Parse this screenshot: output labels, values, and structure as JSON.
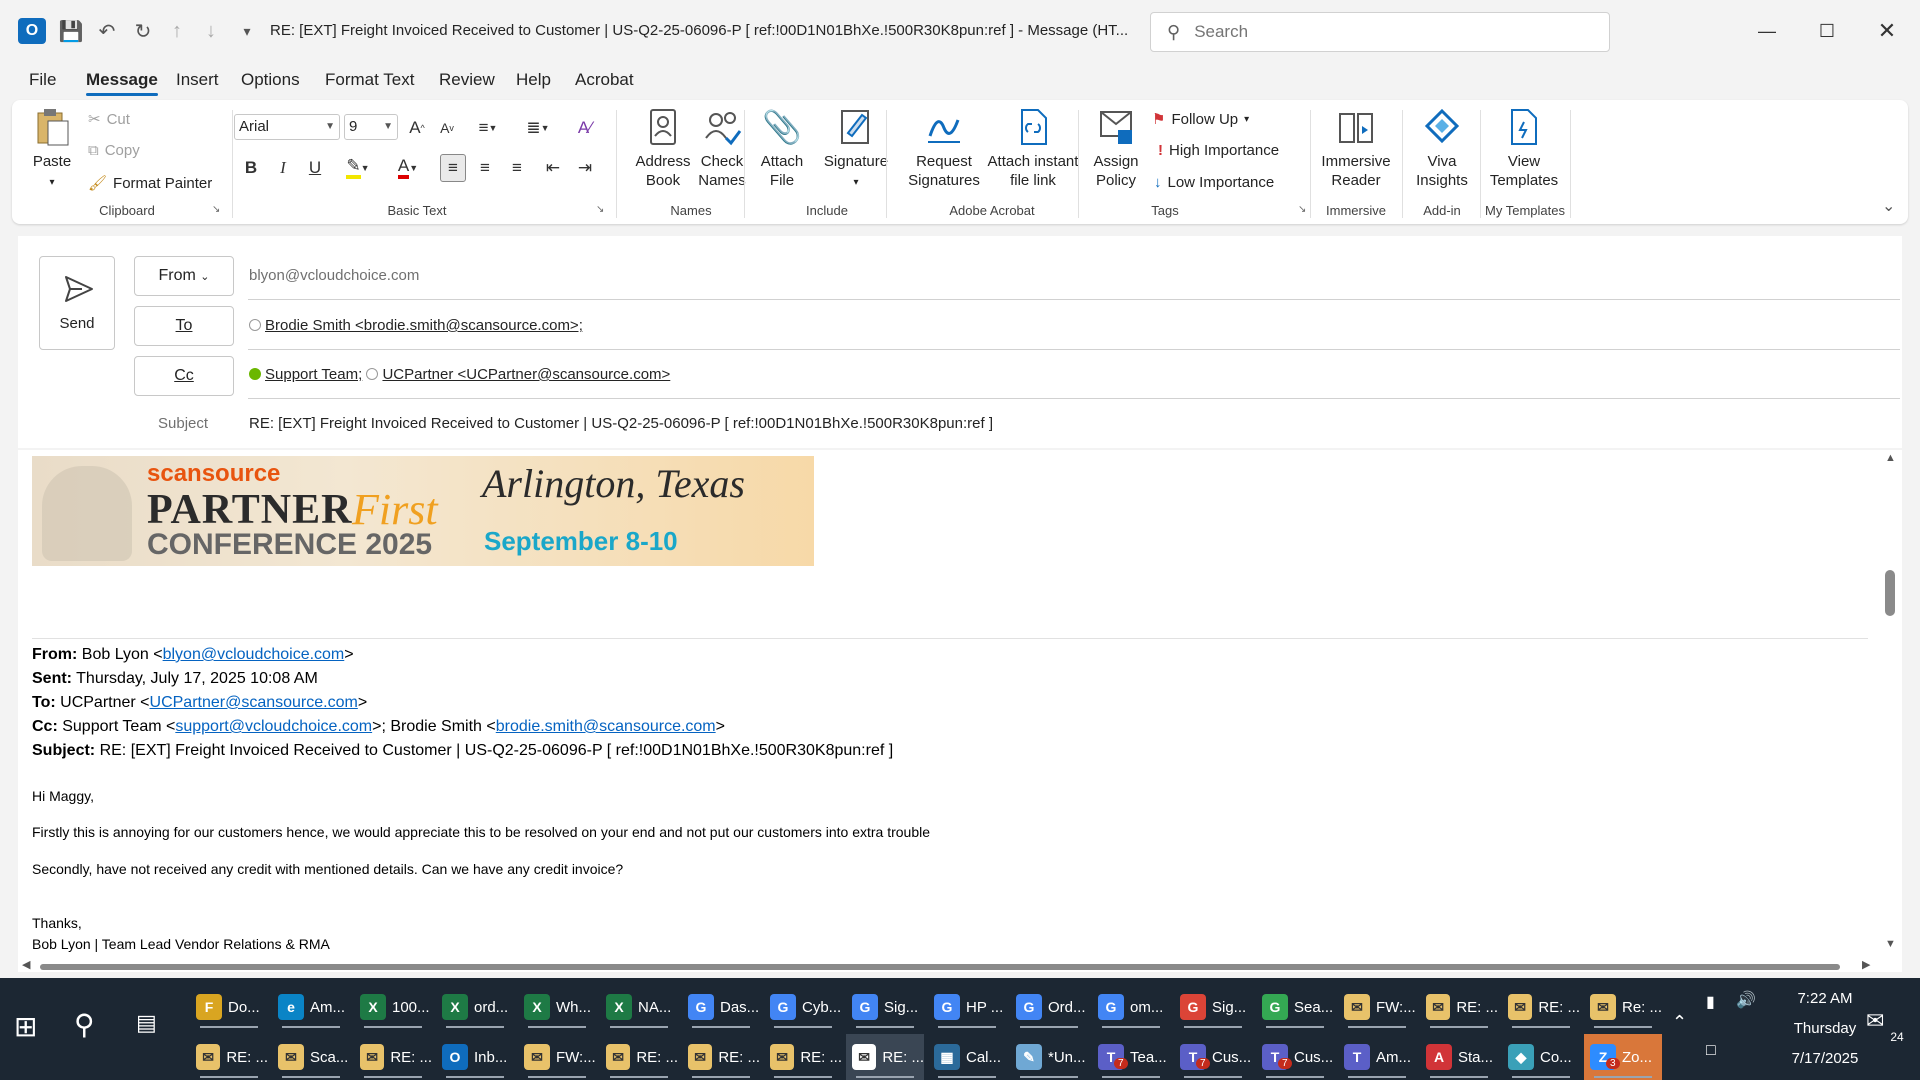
{
  "window": {
    "title": "RE: [EXT] Freight Invoiced Received to Customer | US-Q2-25-06096-P    [ ref:!00D1N01BhXe.!500R30K8pun:ref ]  -  Message (HT...",
    "search_placeholder": "Search"
  },
  "menu": {
    "tabs": [
      "File",
      "Message",
      "Insert",
      "Options",
      "Format Text",
      "Review",
      "Help",
      "Acrobat"
    ],
    "active": "Message"
  },
  "ribbon": {
    "clipboard": {
      "paste": "Paste",
      "cut": "Cut",
      "copy": "Copy",
      "format_painter": "Format Painter",
      "label": "Clipboard"
    },
    "basic_text": {
      "font": "Arial",
      "size": "9",
      "label": "Basic Text"
    },
    "names": {
      "address_book": "Address Book",
      "check_names": "Check Names",
      "label": "Names"
    },
    "include": {
      "attach_file": "Attach File",
      "signature": "Signature",
      "label": "Include"
    },
    "adobe": {
      "request_signatures": "Request Signatures",
      "attach_instant": "Attach instant file link",
      "label": "Adobe Acrobat"
    },
    "tags": {
      "assign_policy": "Assign Policy",
      "follow_up": "Follow Up",
      "high_importance": "High Importance",
      "low_importance": "Low Importance",
      "label": "Tags"
    },
    "immersive": {
      "immersive_reader": "Immersive Reader",
      "label": "Immersive"
    },
    "addin": {
      "viva": "Viva Insights",
      "label": "Add-in"
    },
    "templates": {
      "view": "View Templates",
      "label": "My Templates"
    }
  },
  "compose": {
    "send": "Send",
    "from_label": "From",
    "from_value": "blyon@vcloudchoice.com",
    "to_label": "To",
    "to_value": "Brodie Smith <brodie.smith@scansource.com>;",
    "cc_label": "Cc",
    "cc_value_1": "Support Team;",
    "cc_value_2": "UCPartner <UCPartner@scansource.com>",
    "subject_label": "Subject",
    "subject_value": "RE: [EXT] Freight Invoiced Received to Customer | US-Q2-25-06096-P    [ ref:!00D1N01BhXe.!500R30K8pun:ref ]"
  },
  "banner": {
    "brand": "scansource",
    "line1": "PARTNER",
    "line1b": "First",
    "line2": "CONFERENCE 2025",
    "city": "Arlington, Texas",
    "dates": "September 8-10"
  },
  "quoted": {
    "from_label": "From:",
    "from_name": "Bob Lyon <",
    "from_email": "blyon@vcloudchoice.com",
    "sent_label": "Sent:",
    "sent_value": "Thursday, July 17, 2025 10:08 AM",
    "to_label": "To:",
    "to_name": "UCPartner <",
    "to_email": "UCPartner@scansource.com",
    "cc_label": "Cc:",
    "cc_name1": "Support Team <",
    "cc_email1": "support@vcloudchoice.com",
    "cc_name2": ">; Brodie Smith <",
    "cc_email2": "brodie.smith@scansource.com",
    "subject_label": "Subject:",
    "subject_value": "RE: [EXT] Freight Invoiced Received to Customer | US-Q2-25-06096-P [ ref:!00D1N01BhXe.!500R30K8pun:ref ]"
  },
  "message": {
    "greeting": "Hi Maggy,",
    "p1": "Firstly this is annoying for our customers hence, we would appreciate this to be resolved on your end and not put our customers into extra trouble",
    "p2": "Secondly, have not received any credit with mentioned details. Can we have any credit invoice?",
    "thanks": "Thanks,",
    "sig": "Bob Lyon | Team Lead Vendor Relations & RMA"
  },
  "taskbar": {
    "row1": [
      "Do...",
      "Am...",
      "100...",
      "ord...",
      "Wh...",
      "NA...",
      "Das...",
      "Cyb...",
      "Sig...",
      "HP ...",
      "Ord...",
      "om...",
      "Sig...",
      "Sea...",
      "FW:...",
      "RE: ...",
      "RE: ...",
      "Re: ..."
    ],
    "row2": [
      "RE: ...",
      "Sca...",
      "RE: ...",
      "Inb...",
      "FW:...",
      "RE: ...",
      "RE: ...",
      "RE: ...",
      "RE: ...",
      "Cal...",
      "*Un...",
      "Tea...",
      "Cus...",
      "Cus...",
      "Am...",
      "Sta...",
      "Co...",
      "Zo..."
    ],
    "time": "7:22 AM",
    "day": "Thursday",
    "date": "7/17/2025",
    "notifications": "24",
    "badge_teams": "7",
    "badge_zoom": "3"
  }
}
